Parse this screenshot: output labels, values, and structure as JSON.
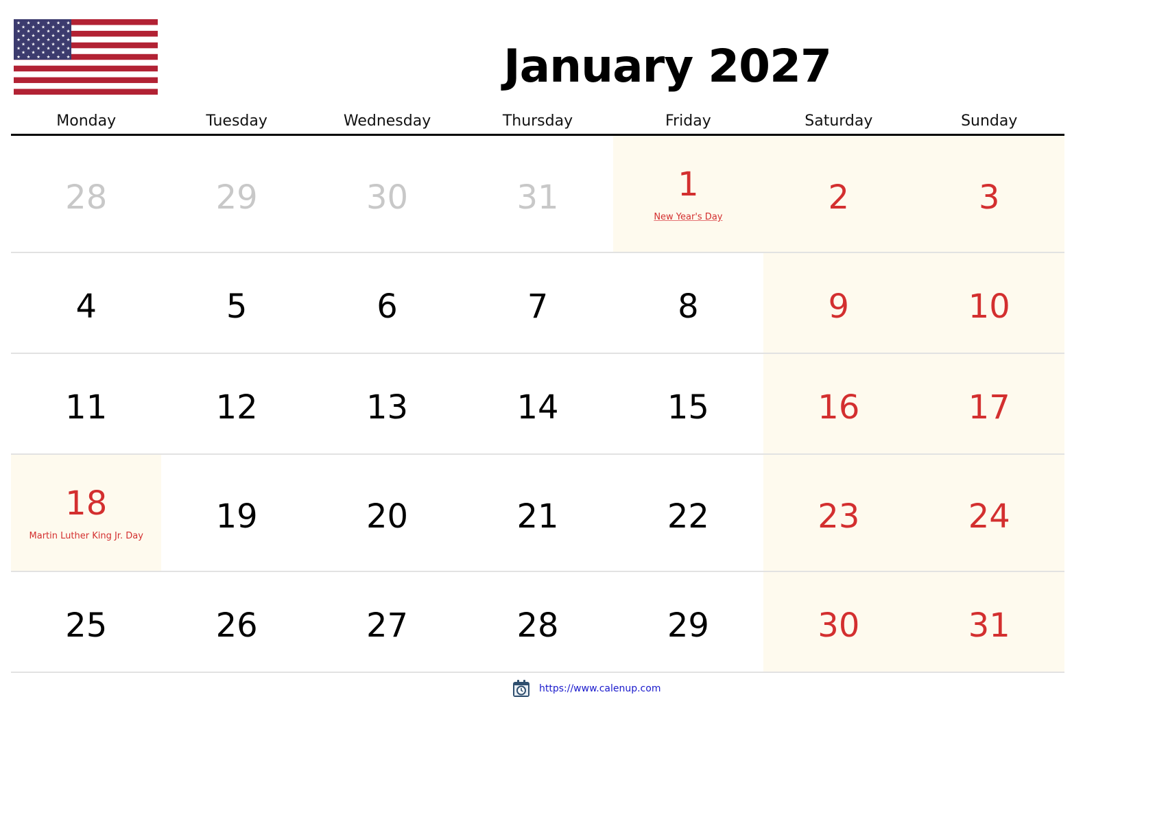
{
  "title": "January 2027",
  "flag": {
    "icon": "us-flag-icon",
    "colors": {
      "red": "#b22234",
      "white": "#ffffff",
      "blue": "#3c3b6e"
    }
  },
  "weekdays": [
    "Monday",
    "Tuesday",
    "Wednesday",
    "Thursday",
    "Friday",
    "Saturday",
    "Sunday"
  ],
  "colors": {
    "weekend_red": "#d32f2f",
    "muted": "#c8c8c8",
    "highlight_bg": "#fefaee",
    "link": "#1a1acc"
  },
  "weeks": [
    [
      {
        "day": "28",
        "muted": true
      },
      {
        "day": "29",
        "muted": true
      },
      {
        "day": "30",
        "muted": true
      },
      {
        "day": "31",
        "muted": true
      },
      {
        "day": "1",
        "red": true,
        "highlight": true,
        "holiday": "New Year's Day",
        "holiday_link": true
      },
      {
        "day": "2",
        "red": true,
        "highlight": true
      },
      {
        "day": "3",
        "red": true,
        "highlight": true
      }
    ],
    [
      {
        "day": "4"
      },
      {
        "day": "5"
      },
      {
        "day": "6"
      },
      {
        "day": "7"
      },
      {
        "day": "8"
      },
      {
        "day": "9",
        "red": true,
        "highlight": true
      },
      {
        "day": "10",
        "red": true,
        "highlight": true
      }
    ],
    [
      {
        "day": "11"
      },
      {
        "day": "12"
      },
      {
        "day": "13"
      },
      {
        "day": "14"
      },
      {
        "day": "15"
      },
      {
        "day": "16",
        "red": true,
        "highlight": true
      },
      {
        "day": "17",
        "red": true,
        "highlight": true
      }
    ],
    [
      {
        "day": "18",
        "red": true,
        "highlight": true,
        "holiday": "Martin Luther King Jr. Day"
      },
      {
        "day": "19"
      },
      {
        "day": "20"
      },
      {
        "day": "21"
      },
      {
        "day": "22"
      },
      {
        "day": "23",
        "red": true,
        "highlight": true
      },
      {
        "day": "24",
        "red": true,
        "highlight": true
      }
    ],
    [
      {
        "day": "25"
      },
      {
        "day": "26"
      },
      {
        "day": "27"
      },
      {
        "day": "28"
      },
      {
        "day": "29"
      },
      {
        "day": "30",
        "red": true,
        "highlight": true
      },
      {
        "day": "31",
        "red": true,
        "highlight": true
      }
    ]
  ],
  "footer": {
    "icon": "calendar-clock-icon",
    "link_text": "https://www.calenup.com"
  }
}
